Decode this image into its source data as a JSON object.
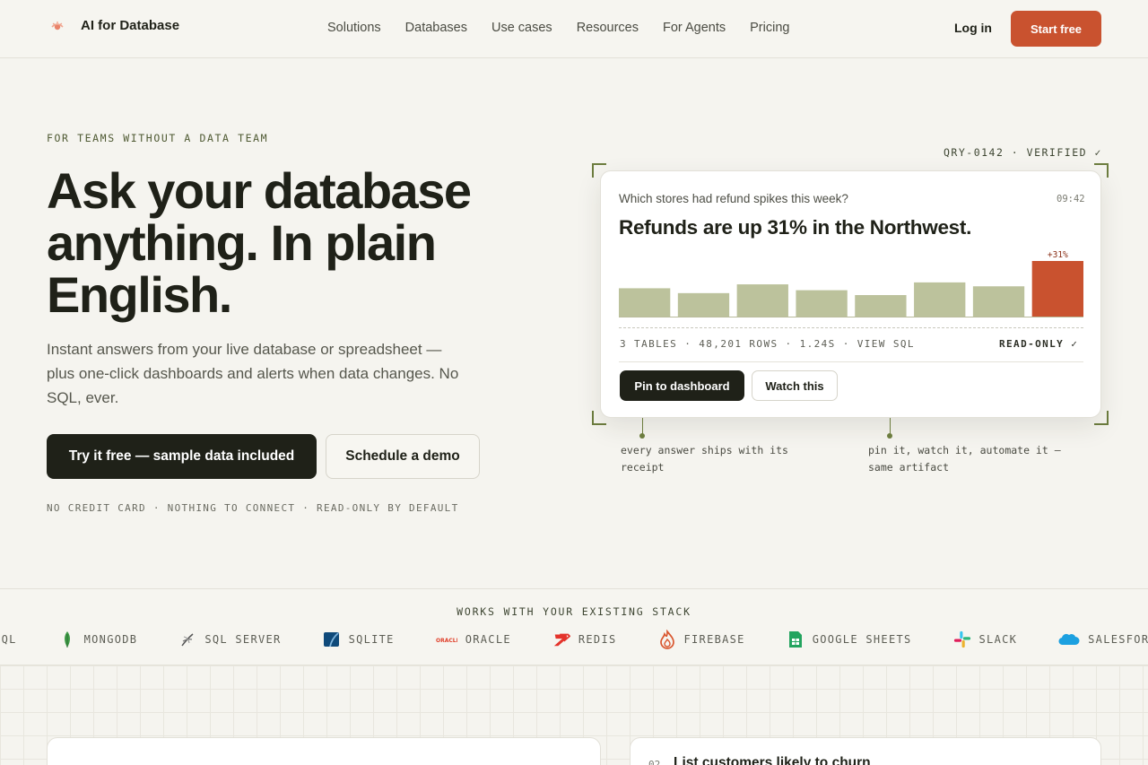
{
  "nav": {
    "brand": "AI for Database",
    "links": [
      "Solutions",
      "Databases",
      "Use cases",
      "Resources",
      "For Agents",
      "Pricing"
    ],
    "login": "Log in",
    "start": "Start free"
  },
  "hero": {
    "eyebrow": "FOR TEAMS WITHOUT A DATA TEAM",
    "title_lines": [
      "Ask your database",
      "anything. In plain",
      "English."
    ],
    "subtitle": "Instant answers from your live database or spreadsheet — plus one-click dashboards and alerts when data changes. No SQL, ever.",
    "primary_cta": "Try it free — sample data included",
    "secondary_cta": "Schedule a demo",
    "fineprint": "NO CREDIT CARD · NOTHING TO CONNECT · READ-ONLY BY DEFAULT"
  },
  "answer_card": {
    "tag": "QRY-0142 · VERIFIED ✓",
    "question": "Which stores had refund spikes this week?",
    "time": "09:42",
    "answer": "Refunds are up 31% in the Northwest.",
    "meta": "3 TABLES · 48,201 ROWS · 1.24S · VIEW SQL",
    "readonly": "READ-ONLY ✓",
    "pin_label": "Pin to dashboard",
    "watch_label": "Watch this",
    "note_left": "every answer ships with its receipt",
    "note_right": "pin it, watch it, automate it — same artifact"
  },
  "chart_data": {
    "type": "bar",
    "values": [
      30,
      25,
      34,
      28,
      23,
      36,
      32,
      58
    ],
    "highlight_index": 7,
    "highlight_label": "+31%",
    "colors": {
      "normal": "#bcc29c",
      "highlight": "#c9522f"
    }
  },
  "stack": {
    "title": "WORKS WITH YOUR EXISTING STACK",
    "logos": [
      {
        "label": "MYSQL",
        "icon": "mysql-icon"
      },
      {
        "label": "MONGODB",
        "icon": "mongodb-icon"
      },
      {
        "label": "SQL SERVER",
        "icon": "sql-server-icon"
      },
      {
        "label": "SQLITE",
        "icon": "sqlite-icon"
      },
      {
        "label": "ORACLE",
        "icon": "oracle-icon"
      },
      {
        "label": "REDIS",
        "icon": "redis-icon"
      },
      {
        "label": "FIREBASE",
        "icon": "firebase-icon"
      },
      {
        "label": "GOOGLE SHEETS",
        "icon": "google-sheets-icon"
      },
      {
        "label": "SLACK",
        "icon": "slack-icon"
      },
      {
        "label": "SALESFORCE",
        "icon": "salesforce-icon"
      }
    ]
  },
  "feature_cards": [
    {
      "number": "",
      "title": ""
    },
    {
      "number": "02",
      "title": "List customers likely to churn"
    }
  ],
  "colors": {
    "accent": "#c9522f",
    "dark": "#1f2118",
    "olive": "#6d7d3f",
    "background": "#f5f4ef"
  }
}
